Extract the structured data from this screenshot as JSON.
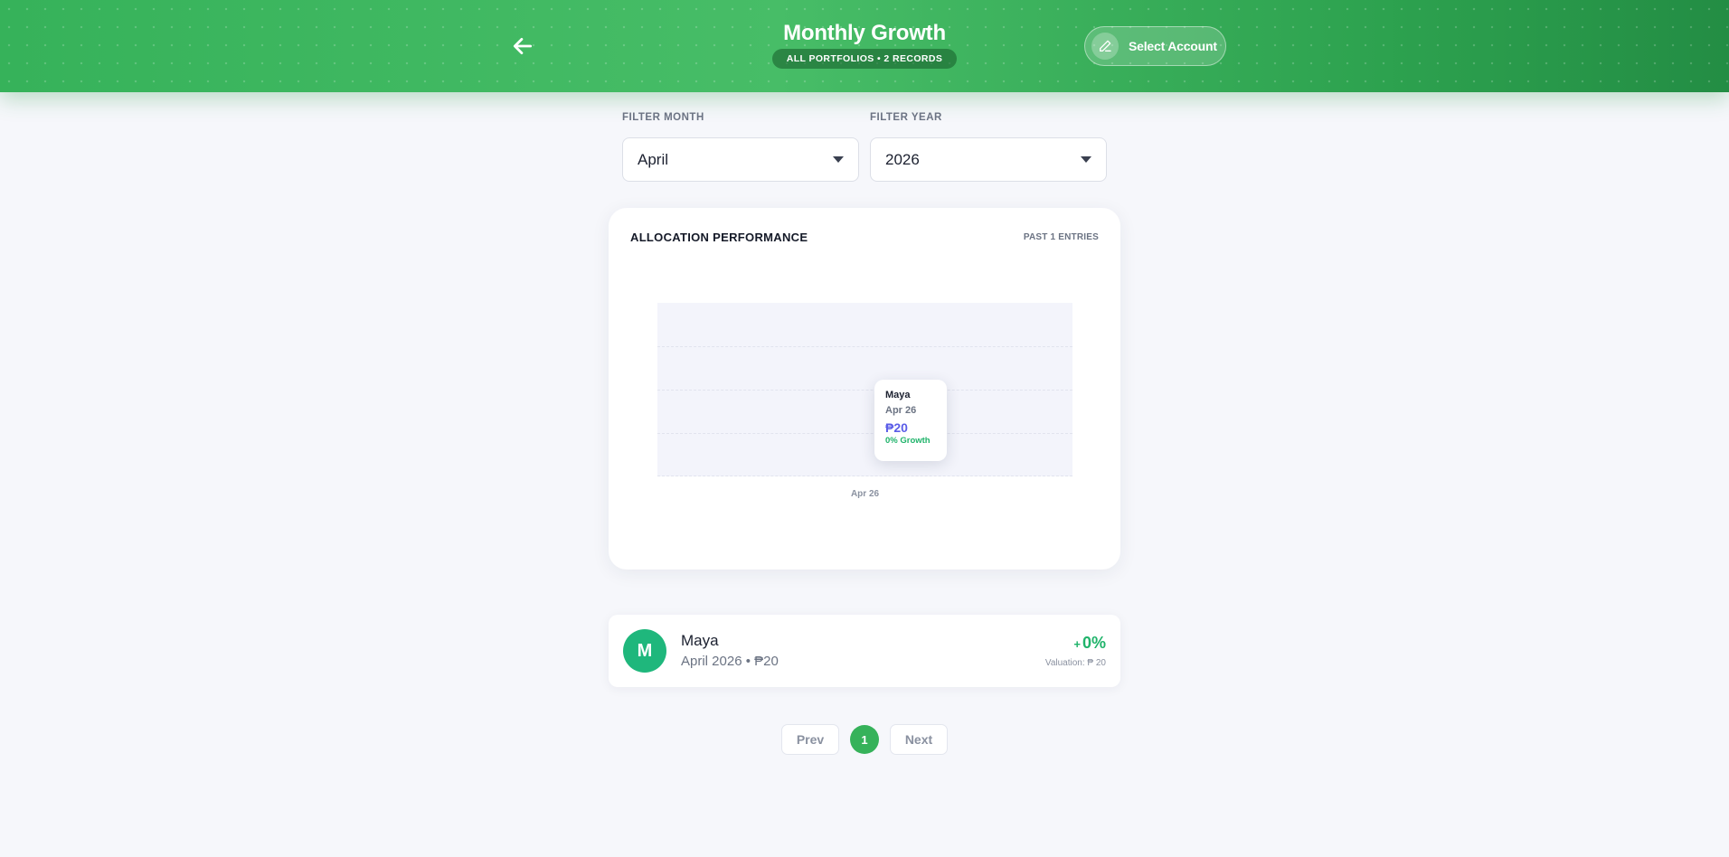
{
  "header": {
    "title": "Monthly Growth",
    "subtitle": "ALL PORTFOLIOS • 2 RECORDS",
    "select_account_label": "Select Account",
    "back_icon": "arrow-left-icon",
    "edit_icon": "pencil-icon"
  },
  "filters": {
    "month_label": "FILTER MONTH",
    "month_value": "April",
    "year_label": "FILTER YEAR",
    "year_value": "2026"
  },
  "chart_card": {
    "title": "ALLOCATION PERFORMANCE",
    "entries_label": "PAST 1 ENTRIES",
    "tooltip": {
      "name": "Maya",
      "date": "Apr 26",
      "value": "₱20",
      "growth": "0% Growth"
    }
  },
  "chart_data": {
    "type": "area",
    "categories": [
      "Apr 26"
    ],
    "series": [
      {
        "values": [
          20
        ]
      }
    ],
    "grid": true
  },
  "records": [
    {
      "initial": "M",
      "name": "Maya",
      "meta": "April 2026 • ₱20",
      "growth_sign": "+",
      "growth": "0%",
      "valuation": "Valuation: ₱ 20"
    }
  ],
  "pagination": {
    "prev_label": "Prev",
    "current_page": "1",
    "next_label": "Next"
  },
  "colors": {
    "brand": "#36b25a",
    "accent": "#5b5de8",
    "positive": "#1fb36a",
    "avatar": "#1fb77c",
    "background": "#f6f7fb"
  }
}
